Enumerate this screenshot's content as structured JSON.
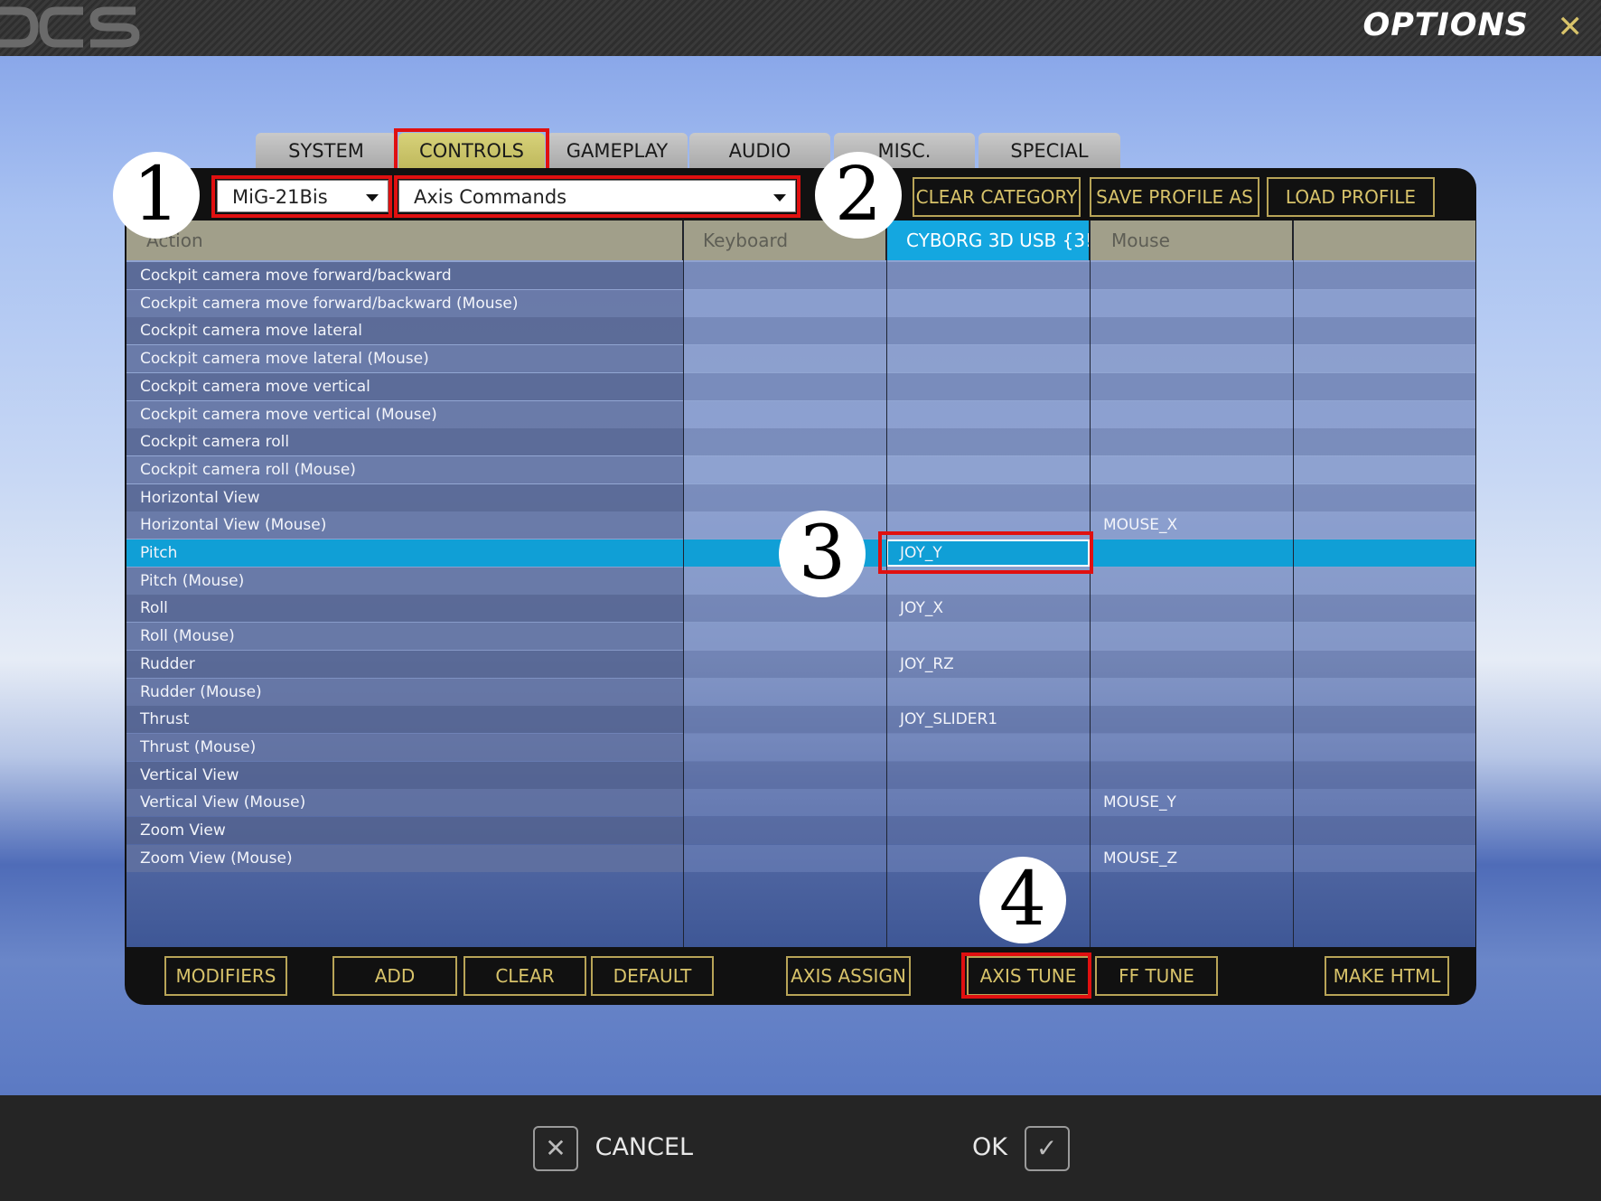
{
  "window": {
    "title": "OPTIONS",
    "close_glyph": "✕",
    "logo": "DCS"
  },
  "tabs": [
    {
      "label": "SYSTEM",
      "active": false
    },
    {
      "label": "CONTROLS",
      "active": true
    },
    {
      "label": "GAMEPLAY",
      "active": false
    },
    {
      "label": "AUDIO",
      "active": false
    },
    {
      "label": "MISC.",
      "active": false
    },
    {
      "label": "SPECIAL",
      "active": false
    }
  ],
  "aircraft_select": {
    "value": "MiG-21Bis"
  },
  "category_select": {
    "value": "Axis Commands"
  },
  "top_buttons": {
    "clear_category": "CLEAR CATEGORY",
    "save_profile_as": "SAVE PROFILE AS",
    "load_profile": "LOAD PROFILE"
  },
  "columns": [
    "Action",
    "Keyboard",
    "CYBORG 3D USB {3!",
    "Mouse",
    ""
  ],
  "rows": [
    {
      "action": "Cockpit camera move forward/backward",
      "keyboard": "",
      "joystick": "",
      "mouse": ""
    },
    {
      "action": "Cockpit camera move forward/backward (Mouse)",
      "keyboard": "",
      "joystick": "",
      "mouse": ""
    },
    {
      "action": "Cockpit camera move lateral",
      "keyboard": "",
      "joystick": "",
      "mouse": ""
    },
    {
      "action": "Cockpit camera move lateral (Mouse)",
      "keyboard": "",
      "joystick": "",
      "mouse": ""
    },
    {
      "action": "Cockpit camera move vertical",
      "keyboard": "",
      "joystick": "",
      "mouse": ""
    },
    {
      "action": "Cockpit camera move vertical (Mouse)",
      "keyboard": "",
      "joystick": "",
      "mouse": ""
    },
    {
      "action": "Cockpit camera roll",
      "keyboard": "",
      "joystick": "",
      "mouse": ""
    },
    {
      "action": "Cockpit camera roll (Mouse)",
      "keyboard": "",
      "joystick": "",
      "mouse": ""
    },
    {
      "action": "Horizontal View",
      "keyboard": "",
      "joystick": "",
      "mouse": ""
    },
    {
      "action": "Horizontal View (Mouse)",
      "keyboard": "",
      "joystick": "",
      "mouse": "MOUSE_X"
    },
    {
      "action": "Pitch",
      "keyboard": "",
      "joystick": "JOY_Y",
      "mouse": "",
      "selected": true
    },
    {
      "action": "Pitch (Mouse)",
      "keyboard": "",
      "joystick": "",
      "mouse": ""
    },
    {
      "action": "Roll",
      "keyboard": "",
      "joystick": "JOY_X",
      "mouse": ""
    },
    {
      "action": "Roll (Mouse)",
      "keyboard": "",
      "joystick": "",
      "mouse": ""
    },
    {
      "action": "Rudder",
      "keyboard": "",
      "joystick": "JOY_RZ",
      "mouse": ""
    },
    {
      "action": "Rudder (Mouse)",
      "keyboard": "",
      "joystick": "",
      "mouse": ""
    },
    {
      "action": "Thrust",
      "keyboard": "",
      "joystick": "JOY_SLIDER1",
      "mouse": ""
    },
    {
      "action": "Thrust (Mouse)",
      "keyboard": "",
      "joystick": "",
      "mouse": ""
    },
    {
      "action": "Vertical View",
      "keyboard": "",
      "joystick": "",
      "mouse": ""
    },
    {
      "action": "Vertical View (Mouse)",
      "keyboard": "",
      "joystick": "",
      "mouse": "MOUSE_Y"
    },
    {
      "action": "Zoom View",
      "keyboard": "",
      "joystick": "",
      "mouse": ""
    },
    {
      "action": "Zoom View (Mouse)",
      "keyboard": "",
      "joystick": "",
      "mouse": "MOUSE_Z"
    }
  ],
  "bottom_buttons": {
    "modifiers": "MODIFIERS",
    "add": "ADD",
    "clear": "CLEAR",
    "default": "DEFAULT",
    "axis_assign": "AXIS ASSIGN",
    "axis_tune": "AXIS TUNE",
    "ff_tune": "FF TUNE",
    "make_html": "MAKE HTML"
  },
  "badges": [
    "1",
    "2",
    "3",
    "4"
  ],
  "footer": {
    "cancel": "CANCEL",
    "ok": "OK",
    "cancel_glyph": "✕",
    "ok_glyph": "✓"
  },
  "colors": {
    "accent_gold": "#d8c36a",
    "selection": "#109fd6",
    "highlight": "#e01010"
  }
}
